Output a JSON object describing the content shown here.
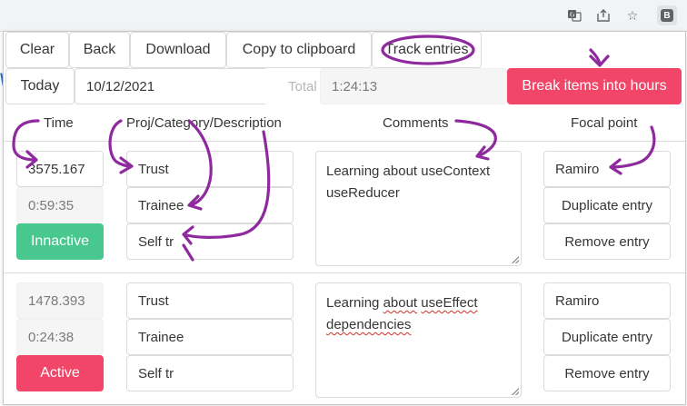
{
  "toolbar": {
    "clear": "Clear",
    "back": "Back",
    "download": "Download",
    "copy": "Copy to clipboard",
    "track": "Track entries"
  },
  "date_row": {
    "today": "Today",
    "date": "10/12/2021",
    "total_label": "Total",
    "total_value": "1:24:13",
    "break_items": "Break items into hours"
  },
  "headers": {
    "time": "Time",
    "proj": "Proj/Category/Description",
    "comments": "Comments",
    "focal": "Focal point"
  },
  "entries": [
    {
      "time_counter": "3575.167",
      "elapsed": "0:59:35",
      "status": "Innactive",
      "project": "Trust",
      "category": "Trainee",
      "description": "Self tr",
      "comment_line1": "Learning about useContext",
      "comment_line2": "useReducer",
      "focal_point": "Ramiro",
      "duplicate": "Duplicate entry",
      "remove": "Remove entry"
    },
    {
      "time_counter": "1478.393",
      "elapsed": "0:24:38",
      "status": "Active",
      "project": "Trust",
      "category": "Trainee",
      "description": "Self tr",
      "comment_line1": "Learning about useEffect",
      "comment_line2": "dependencies",
      "focal_point": "Ramiro",
      "duplicate": "Duplicate entry",
      "remove": "Remove entry"
    }
  ],
  "colors": {
    "inactive_status": "#48c78e",
    "active_status": "#f14668",
    "break_button": "#f14668",
    "annotation": "#8e2a9e"
  },
  "icons": {
    "translate": "translate-icon",
    "share": "share-icon",
    "bookmark": "star-icon",
    "profile": "B"
  }
}
